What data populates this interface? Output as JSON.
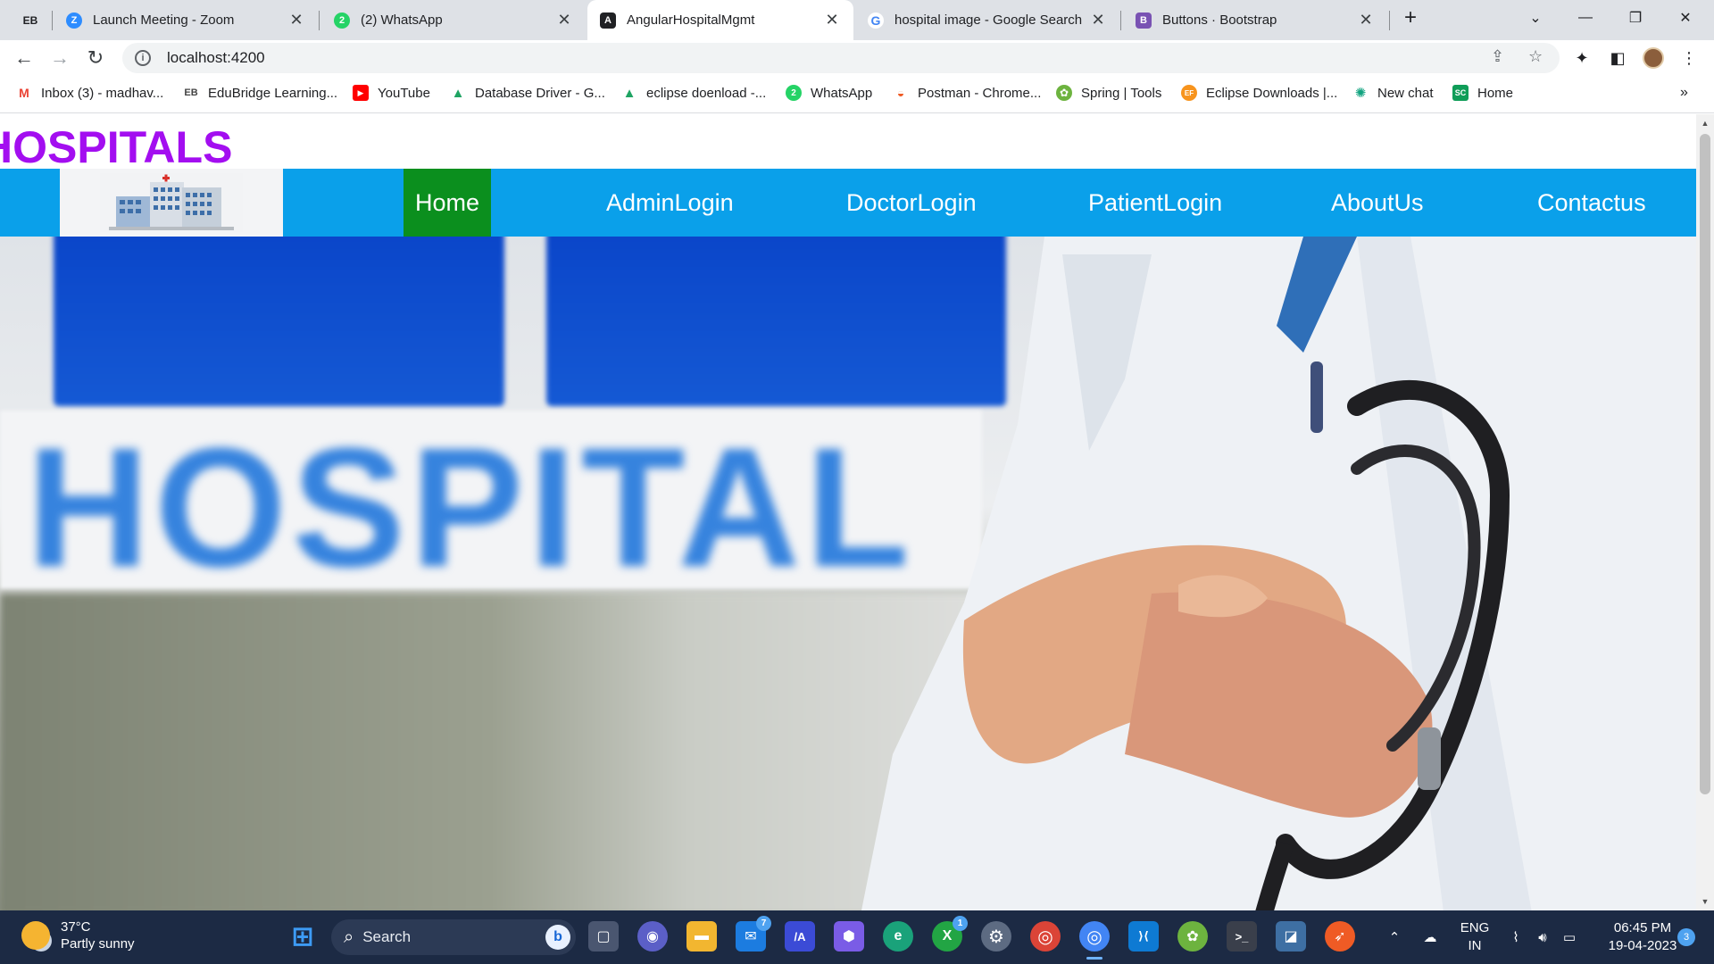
{
  "browser": {
    "tabs": [
      {
        "title": "Launch Meeting - Zoom",
        "icon": "zoom-icon",
        "color": "#2d8cff"
      },
      {
        "title": "(2) WhatsApp",
        "icon": "whatsapp-icon",
        "color": "#25d366"
      },
      {
        "title": "AngularHospitalMgmt",
        "icon": "angular-icon",
        "color": "#202124"
      },
      {
        "title": "hospital image - Google Search",
        "icon": "google-icon",
        "color": "#4285f4"
      },
      {
        "title": "Buttons · Bootstrap",
        "icon": "bootstrap-icon",
        "color": "#7952b3"
      }
    ],
    "active_tab": "AngularHospitalMgmt",
    "url": "localhost:4200",
    "bookmarks": [
      {
        "label": "Inbox (3) - madhav...",
        "icon": "gmail-icon",
        "color": "#ea4335",
        "glyph": "M"
      },
      {
        "label": "EduBridge Learning...",
        "icon": "edubridge-icon",
        "color": "#444444",
        "glyph": "EB"
      },
      {
        "label": "YouTube",
        "icon": "youtube-icon",
        "color": "#ff0000",
        "glyph": "▶"
      },
      {
        "label": "Database Driver - G...",
        "icon": "drive-icon",
        "color": "#1fa463",
        "glyph": "▲"
      },
      {
        "label": "eclipse doenload -...",
        "icon": "drive-icon",
        "color": "#1fa463",
        "glyph": "▲"
      },
      {
        "label": "WhatsApp",
        "icon": "whatsapp-icon",
        "color": "#25d366",
        "glyph": "2"
      },
      {
        "label": "Postman - Chrome...",
        "icon": "postman-icon",
        "color": "#ef5b25",
        "glyph": "◒"
      },
      {
        "label": "Spring | Tools",
        "icon": "spring-icon",
        "color": "#6db33f",
        "glyph": "✿"
      },
      {
        "label": "Eclipse Downloads |...",
        "icon": "eclipse-icon",
        "color": "#f7941e",
        "glyph": "EF"
      },
      {
        "label": "New chat",
        "icon": "openai-icon",
        "color": "#10a37f",
        "glyph": "✺"
      },
      {
        "label": "Home",
        "icon": "sc-icon",
        "color": "#0f9d58",
        "glyph": "SC"
      }
    ]
  },
  "page": {
    "site_title": "HOSPITALS",
    "nav": [
      {
        "label": "Home"
      },
      {
        "label": "AdminLogin"
      },
      {
        "label": "DoctorLogin"
      },
      {
        "label": "PatientLogin"
      },
      {
        "label": "AboutUs"
      },
      {
        "label": "Contactus"
      }
    ],
    "active_nav": "Home",
    "hero_sign_text": "HOSPITAL",
    "colors": {
      "title": "#a30ef0",
      "navbar": "#0aa0ea",
      "active_nav": "#0b8f1e"
    }
  },
  "taskbar": {
    "weather_temp": "37°C",
    "weather_desc": "Partly sunny",
    "search_placeholder": "Search",
    "bing_glyph": "b",
    "apps": [
      {
        "name": "start-icon",
        "glyph": "⊞",
        "color": "#2b7de9"
      },
      {
        "name": "task-view-icon",
        "glyph": "▢",
        "color": "#4a5670"
      },
      {
        "name": "teams-chat-icon",
        "glyph": "◉",
        "color": "#5b5fc7"
      },
      {
        "name": "file-explorer-icon",
        "glyph": "▬",
        "color": "#f2b630"
      },
      {
        "name": "mail-icon",
        "glyph": "✉",
        "color": "#1c7ce0",
        "badge": "7"
      },
      {
        "name": "stylus-app-icon",
        "glyph": "/A",
        "color": "#3b4bd6"
      },
      {
        "name": "clipchamp-icon",
        "glyph": "⬢",
        "color": "#7a5ce6"
      },
      {
        "name": "edge-icon",
        "glyph": "e",
        "color": "#1aa27a"
      },
      {
        "name": "xbox-icon",
        "glyph": "X",
        "color": "#22a544",
        "badge": "1"
      },
      {
        "name": "settings-icon",
        "glyph": "⚙",
        "color": "#5d6b82"
      },
      {
        "name": "chrome-icon",
        "glyph": "◎",
        "color": "#db4437"
      },
      {
        "name": "chrome-profile-icon",
        "glyph": "◎",
        "color": "#4285f4"
      },
      {
        "name": "vscode-icon",
        "glyph": "⟩⟨",
        "color": "#0e7ad3"
      },
      {
        "name": "spring-tools-icon",
        "glyph": "✿",
        "color": "#6db33f"
      },
      {
        "name": "terminal-icon",
        "glyph": ">_",
        "color": "#3a3f4b"
      },
      {
        "name": "mysql-workbench-icon",
        "glyph": "◪",
        "color": "#3e6fa3"
      },
      {
        "name": "postman-icon",
        "glyph": "➶",
        "color": "#ef5b25"
      }
    ],
    "lang_top": "ENG",
    "lang_bottom": "IN",
    "time": "06:45 PM",
    "date": "19-04-2023",
    "notifications": "3"
  }
}
